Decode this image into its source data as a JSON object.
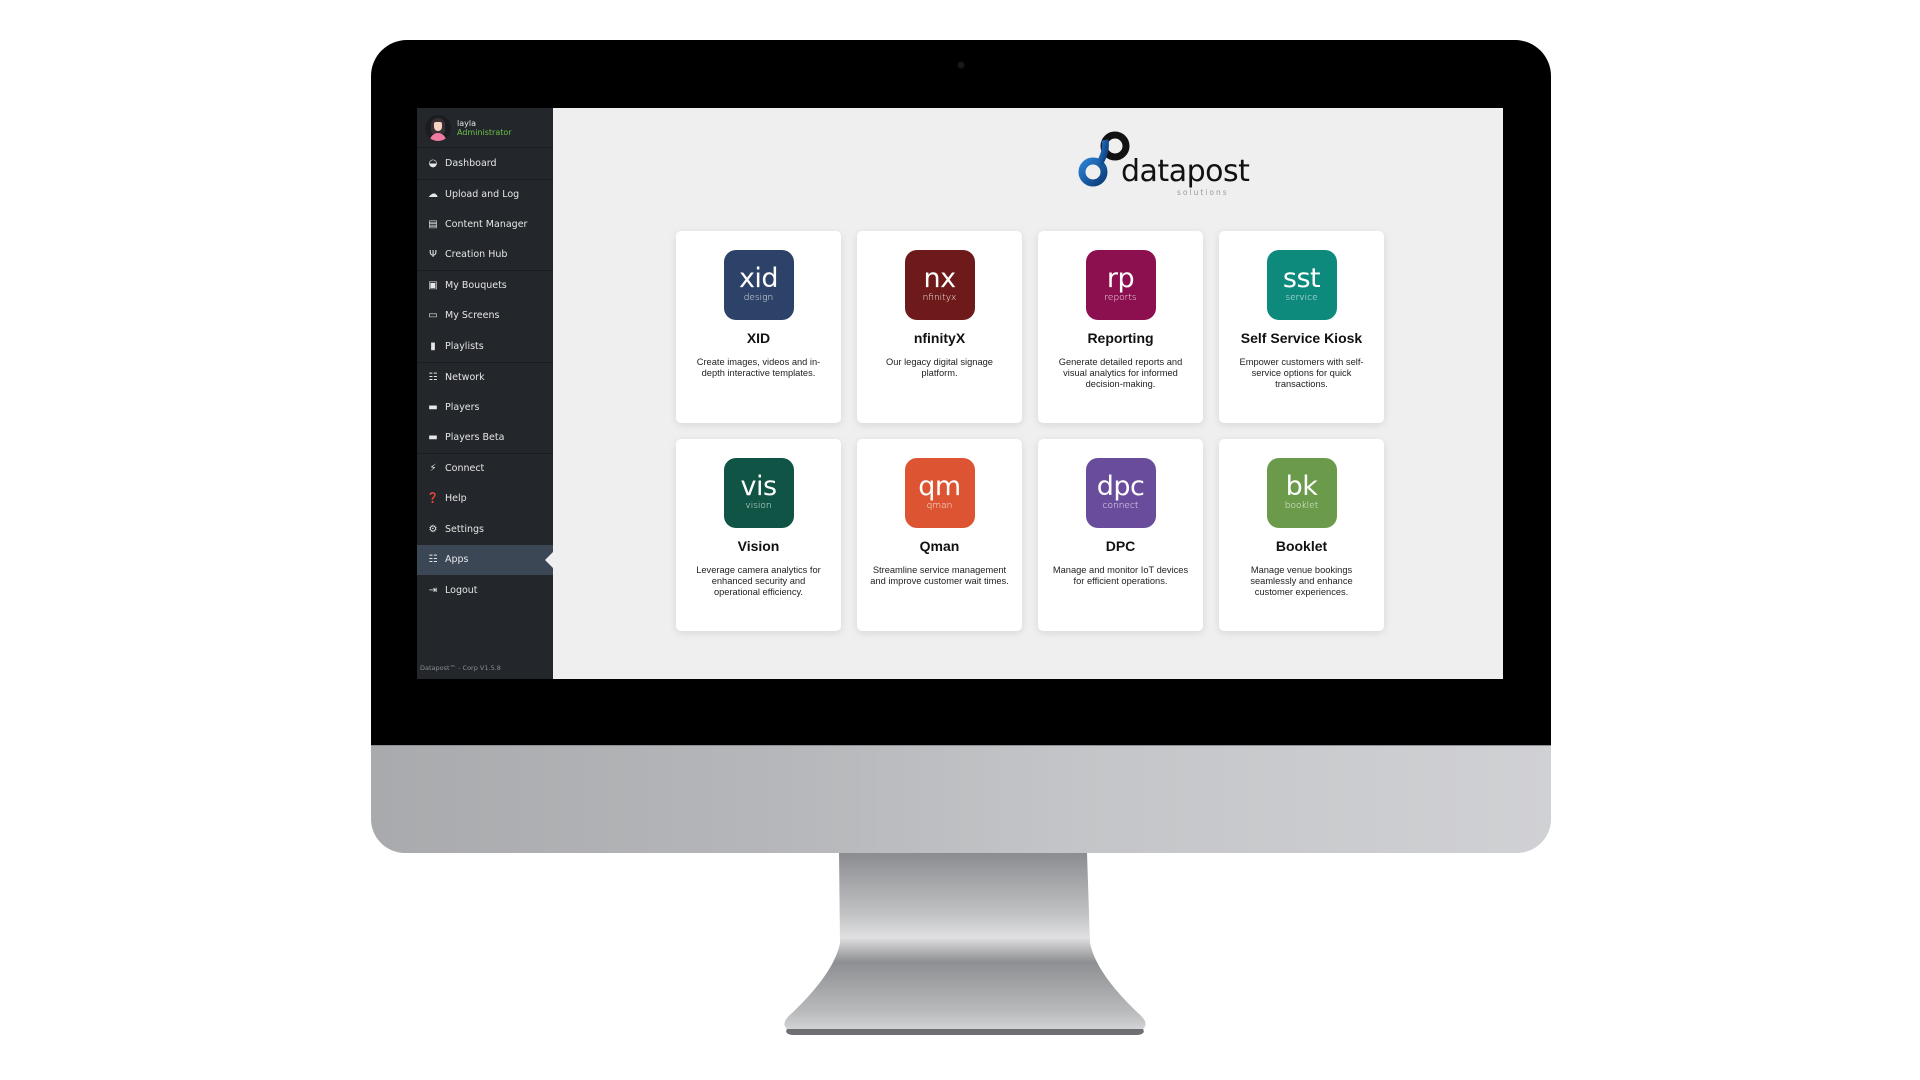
{
  "user": {
    "name": "layla",
    "role": "Administrator"
  },
  "sidebar": {
    "items": [
      {
        "label": "Dashboard",
        "icon": "dashboard-icon",
        "glyph": "◒",
        "sep": false,
        "active": false
      },
      {
        "label": "Upload and Log",
        "icon": "cloud-upload-icon",
        "glyph": "☁",
        "sep": true,
        "active": false
      },
      {
        "label": "Content Manager",
        "icon": "book-icon",
        "glyph": "▤",
        "sep": false,
        "active": false
      },
      {
        "label": "Creation Hub",
        "icon": "creation-hub-icon",
        "glyph": "Ψ",
        "sep": false,
        "active": false
      },
      {
        "label": "My Bouquets",
        "icon": "archive-icon",
        "glyph": "▣",
        "sep": true,
        "active": false
      },
      {
        "label": "My Screens",
        "icon": "monitor-icon",
        "glyph": "▭",
        "sep": false,
        "active": false
      },
      {
        "label": "Playlists",
        "icon": "file-icon",
        "glyph": "▮",
        "sep": false,
        "active": false
      },
      {
        "label": "Network",
        "icon": "sitemap-icon",
        "glyph": "☷",
        "sep": true,
        "active": false
      },
      {
        "label": "Players",
        "icon": "player-device-icon",
        "glyph": "▬",
        "sep": false,
        "active": false
      },
      {
        "label": "Players Beta",
        "icon": "player-device-icon",
        "glyph": "▬",
        "sep": false,
        "active": false
      },
      {
        "label": "Connect",
        "icon": "plug-icon",
        "glyph": "⚡",
        "sep": true,
        "active": false
      },
      {
        "label": "Help",
        "icon": "question-circle-icon",
        "glyph": "❓",
        "sep": false,
        "active": false
      },
      {
        "label": "Settings",
        "icon": "gear-icon",
        "glyph": "⚙",
        "sep": false,
        "active": false
      },
      {
        "label": "Apps",
        "icon": "grid-icon",
        "glyph": "☷",
        "sep": false,
        "active": true
      },
      {
        "label": "Logout",
        "icon": "sign-out-icon",
        "glyph": "⇥",
        "sep": false,
        "active": false
      }
    ],
    "version": "Datapost™ - Corp V1.5.8"
  },
  "logo": {
    "word": "datapost",
    "sub": "solutions",
    "colors": {
      "blue": "#1f6fc4",
      "dark": "#111111"
    }
  },
  "apps": [
    {
      "abbr": "xid",
      "sub": "design",
      "title": "XID",
      "desc": "Create images, videos and in-depth interactive templates.",
      "color": "#2c4268"
    },
    {
      "abbr": "nx",
      "sub": "nfinityx",
      "title": "nfinityX",
      "desc": "Our legacy digital signage platform.",
      "color": "#6e1a1a"
    },
    {
      "abbr": "rp",
      "sub": "reports",
      "title": "Reporting",
      "desc": "Generate detailed reports and visual analytics for informed decision-making.",
      "color": "#8c0f4f"
    },
    {
      "abbr": "sst",
      "sub": "service",
      "title": "Self Service Kiosk",
      "desc": "Empower customers with self-service options for quick transactions.",
      "color": "#0e8a7c"
    },
    {
      "abbr": "vis",
      "sub": "vision",
      "title": "Vision",
      "desc": "Leverage camera analytics for enhanced security and operational efficiency.",
      "color": "#0f5444"
    },
    {
      "abbr": "qm",
      "sub": "qman",
      "title": "Qman",
      "desc": "Streamline service management and improve customer wait times.",
      "color": "#dc5431"
    },
    {
      "abbr": "dpc",
      "sub": "connect",
      "title": "DPC",
      "desc": "Manage and monitor IoT devices for efficient operations.",
      "color": "#6a4c9c"
    },
    {
      "abbr": "bk",
      "sub": "booklet",
      "title": "Booklet",
      "desc": "Manage venue bookings seamlessly and enhance customer experiences.",
      "color": "#6a9a4a"
    }
  ]
}
